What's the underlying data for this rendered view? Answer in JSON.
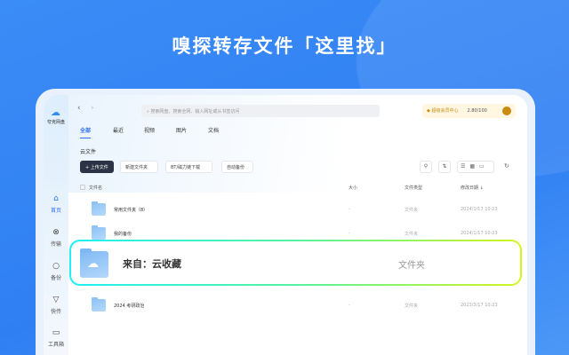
{
  "headline": "嗅探转存文件「这里找」",
  "app": {
    "logo": "夸克网盘",
    "search_placeholder": "搜索网盘、搜索全网、输入网址或从书签访问",
    "vip": "超级会员中心",
    "storage": "2.80/100"
  },
  "sidebar": [
    {
      "label": "首页",
      "icon": "home-icon"
    },
    {
      "label": "传输",
      "icon": "transfer-icon"
    },
    {
      "label": "备份",
      "icon": "backup-icon"
    },
    {
      "label": "快传",
      "icon": "send-icon"
    },
    {
      "label": "工具箱",
      "icon": "toolbox-icon"
    }
  ],
  "tabs": [
    "全部",
    "最近",
    "视频",
    "图片",
    "文档"
  ],
  "section": "云文件",
  "buttons": [
    "+ 上传文件",
    "新建文件夹",
    "BT/磁力链下载",
    "自动备份"
  ],
  "columns": [
    "文件名",
    "大小",
    "文件类型",
    "修改日期 ↓"
  ],
  "rows": [
    {
      "name": "常用文件夹（8）",
      "size": "-",
      "type": "文件夹",
      "date": "2024/1/17 10:23"
    },
    {
      "name": "我的备份",
      "size": "-",
      "type": "文件夹",
      "date": "2024/1/17 10:23"
    },
    {
      "name": "2024 考研政治",
      "size": "-",
      "type": "文件夹",
      "date": "2023/3/17 10:23"
    }
  ],
  "highlight": {
    "name": "来自：云收藏",
    "type": "文件夹"
  }
}
